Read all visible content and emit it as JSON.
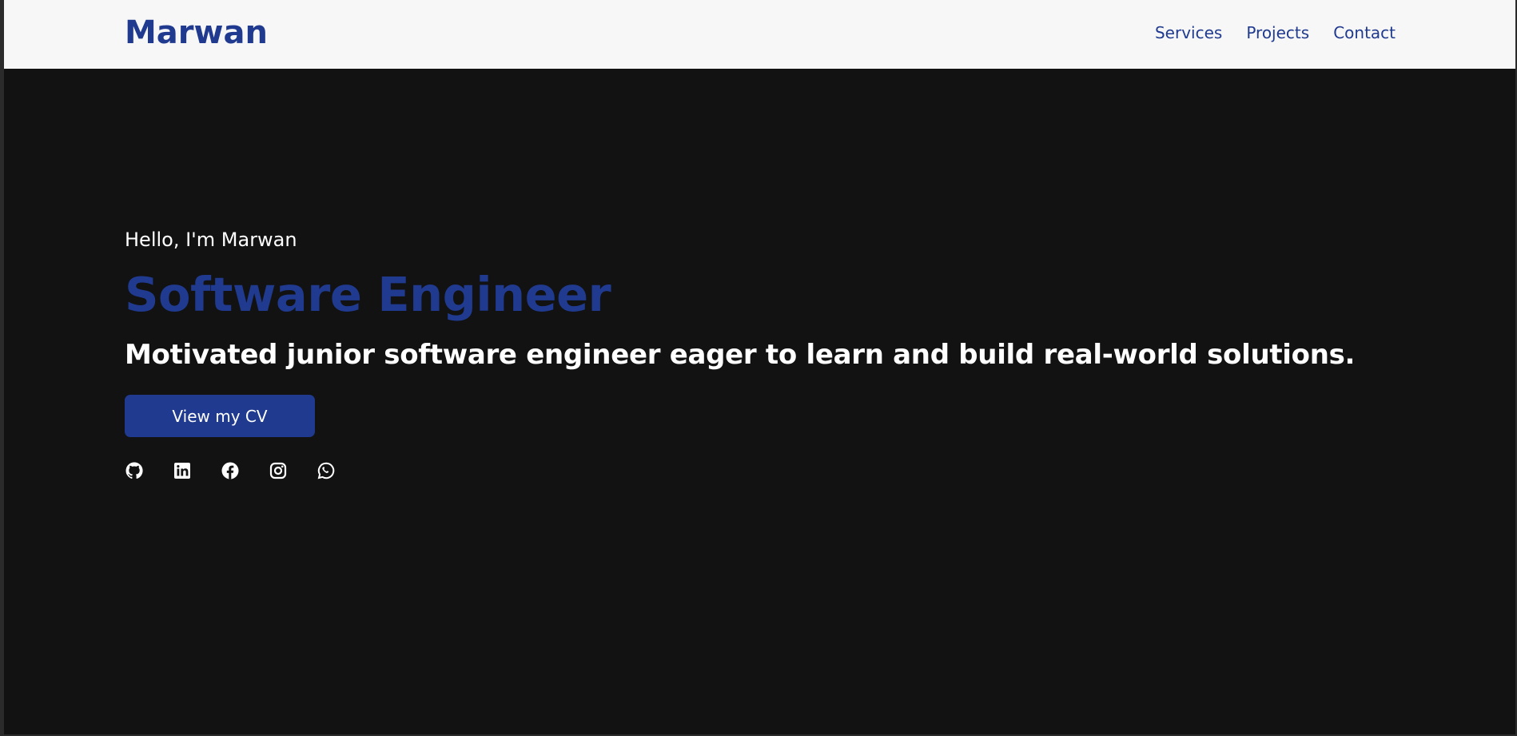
{
  "navbar": {
    "brand": "Marwan",
    "links": [
      {
        "label": "Services"
      },
      {
        "label": "Projects"
      },
      {
        "label": "Contact"
      }
    ]
  },
  "hero": {
    "greeting": "Hello, I'm Marwan",
    "headline": "Software Engineer",
    "tagline": "Motivated junior software engineer eager to learn and build real-world solutions.",
    "cta_label": "View my CV"
  },
  "socials": [
    {
      "icon": "github-icon"
    },
    {
      "icon": "linkedin-icon"
    },
    {
      "icon": "facebook-icon"
    },
    {
      "icon": "instagram-icon"
    },
    {
      "icon": "whatsapp-icon"
    }
  ],
  "colors": {
    "accent": "#1f3a8f",
    "background": "#121212",
    "navbar": "#f7f7f7",
    "text": "#ffffff"
  }
}
